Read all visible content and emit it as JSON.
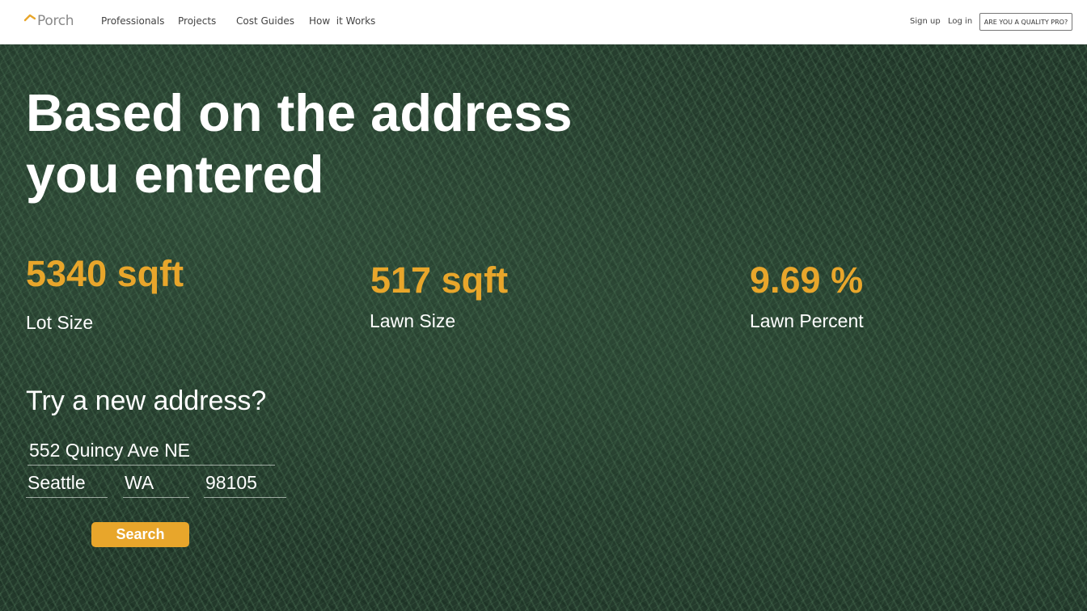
{
  "header": {
    "logo_text": "Porch",
    "nav": [
      "Professionals",
      "Projects",
      "Cost Guides",
      "How  it Works"
    ],
    "sign_up": "Sign up",
    "log_in": "Log in",
    "pro_button": "ARE YOU A QUALITY PRO?"
  },
  "hero": {
    "title_line1": "Based on the address",
    "title_line2": "you entered"
  },
  "stats": [
    {
      "value": "5340 sqft",
      "label": "Lot Size"
    },
    {
      "value": "517 sqft",
      "label": "Lawn Size"
    },
    {
      "value": "9.69 %",
      "label": "Lawn Percent"
    }
  ],
  "form": {
    "heading": "Try a new address?",
    "street": "552 Quincy Ave NE",
    "city": "Seattle",
    "state": "WA",
    "zip": "98105",
    "search_label": "Search"
  },
  "colors": {
    "accent": "#e8a62b",
    "header_bg": "#ffffff",
    "hero_text": "#ffffff"
  },
  "icons": {
    "logo": "porch-roof-icon"
  }
}
